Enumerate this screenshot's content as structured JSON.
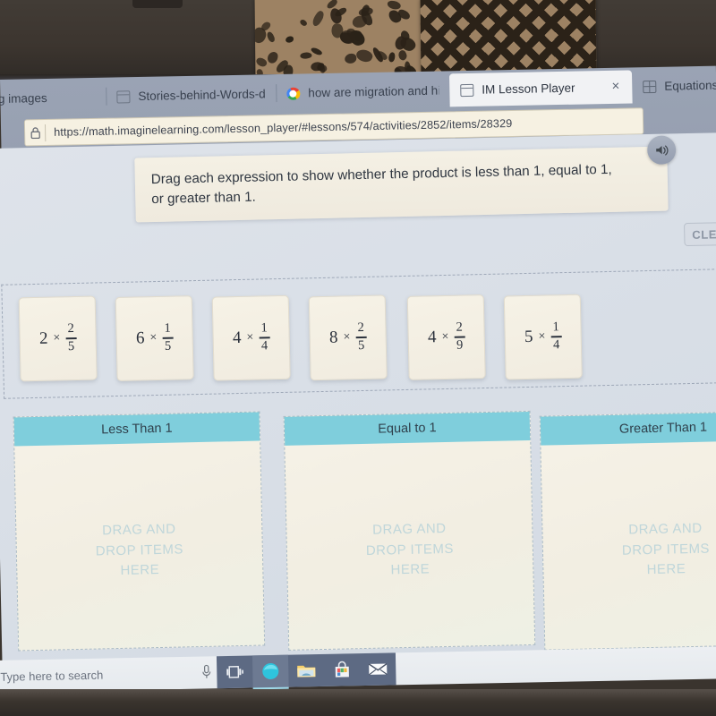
{
  "browser": {
    "tabs": [
      {
        "label": "Bing images",
        "icon": "none",
        "active": false,
        "close": false
      },
      {
        "label": "Stories-behind-Words-denc",
        "icon": "page-icon",
        "active": false,
        "close": false
      },
      {
        "label": "how are migration and hibe",
        "icon": "google-icon",
        "active": false,
        "close": false
      },
      {
        "label": "IM Lesson Player",
        "icon": "page-icon",
        "active": true,
        "close": true
      },
      {
        "label": "Equations sol",
        "icon": "grid-icon",
        "active": false,
        "close": false
      }
    ],
    "close_glyph": "×",
    "url": "https://math.imaginelearning.com/lesson_player/#lessons/574/activities/2852/items/28329",
    "lock_icon": "lock-icon"
  },
  "lesson": {
    "prompt": "Drag each expression to show whether the product is less than 1, equal to 1, or greater than 1.",
    "audio_icon": "speaker-icon",
    "clear_button": "CLEAR",
    "cards": [
      {
        "whole": "2",
        "operator": "×",
        "numerator": "2",
        "denominator": "5"
      },
      {
        "whole": "6",
        "operator": "×",
        "numerator": "1",
        "denominator": "5"
      },
      {
        "whole": "4",
        "operator": "×",
        "numerator": "1",
        "denominator": "4"
      },
      {
        "whole": "8",
        "operator": "×",
        "numerator": "2",
        "denominator": "5"
      },
      {
        "whole": "4",
        "operator": "×",
        "numerator": "2",
        "denominator": "9"
      },
      {
        "whole": "5",
        "operator": "×",
        "numerator": "1",
        "denominator": "4"
      }
    ],
    "zones": [
      {
        "title": "Less Than 1",
        "placeholder": "DRAG AND\nDROP ITEMS\nHERE"
      },
      {
        "title": "Equal to 1",
        "placeholder": "DRAG AND\nDROP ITEMS\nHERE"
      },
      {
        "title": "Greater Than 1",
        "placeholder": "DRAG AND\nDROP ITEMS\nHERE"
      }
    ]
  },
  "taskbar": {
    "search_placeholder": "Type here to search",
    "mic_icon": "microphone-icon",
    "buttons": [
      {
        "icon": "task-view-icon",
        "active": false
      },
      {
        "icon": "edge-browser-icon",
        "active": true
      },
      {
        "icon": "file-explorer-icon",
        "active": false
      },
      {
        "icon": "microsoft-store-icon",
        "active": false
      },
      {
        "icon": "mail-icon",
        "active": false
      }
    ]
  },
  "colors": {
    "zone_header": "#7fcedc",
    "card_bg": "#f4efe3",
    "page_bg": "#dee3ea",
    "prompt_bg": "#f4f0e4",
    "taskbar_bg": "#5d6a83"
  }
}
